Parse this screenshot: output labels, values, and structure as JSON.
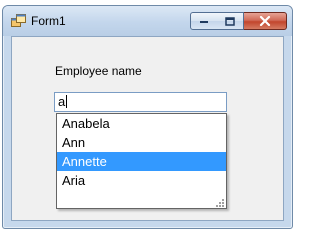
{
  "window": {
    "title": "Form1"
  },
  "form": {
    "label": "Employee name",
    "input_value": "a"
  },
  "autocomplete": {
    "items": [
      "Anabela",
      "Ann",
      "Annette",
      "Aria"
    ],
    "selected": "Annette"
  },
  "icons": {
    "app": "app-icon",
    "minimize": "minimize-icon",
    "maximize": "maximize-icon",
    "close": "close-icon",
    "resize_grip": "resize-grip-icon"
  },
  "colors": {
    "selection": "#3399ff",
    "close_button": "#c2462d"
  }
}
